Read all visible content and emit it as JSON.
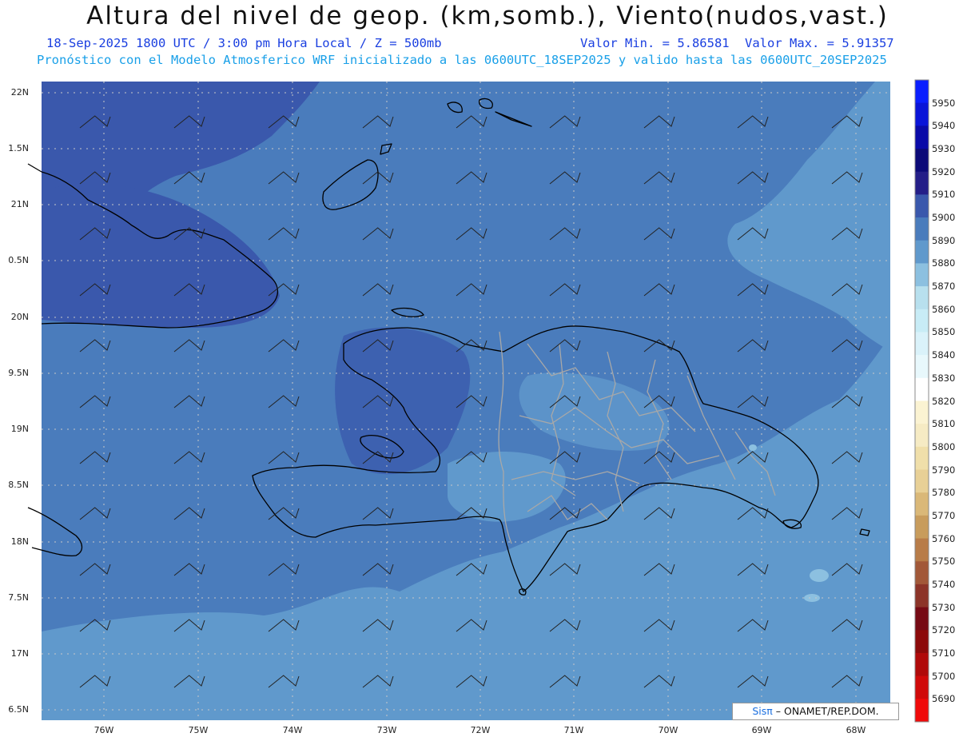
{
  "header": {
    "title": "Altura del nivel de geop. (km,somb.), Viento(nudos,vast.)",
    "date_line": "18-Sep-2025  1800 UTC / 3:00 pm Hora Local / Z = 500mb",
    "min_line": "Valor Min. = 5.86581",
    "max_line": "Valor Max. = 5.91357",
    "model_line": "Pronóstico con el Modelo Atmosferico WRF inicializado a las 0600UTC_18SEP2025 y valido hasta las  0600UTC_20SEP2025"
  },
  "axes": {
    "lat_labels": [
      "22N",
      "1.5N",
      "21N",
      "0.5N",
      "20N",
      "9.5N",
      "19N",
      "8.5N",
      "18N",
      "7.5N",
      "17N",
      "6.5N"
    ],
    "lon_labels": [
      "76W",
      "75W",
      "74W",
      "73W",
      "72W",
      "71W",
      "70W",
      "69W",
      "68W"
    ]
  },
  "colorbar": {
    "levels": [
      "5950",
      "5940",
      "5930",
      "5920",
      "5910",
      "5900",
      "5890",
      "5880",
      "5870",
      "5860",
      "5850",
      "5840",
      "5830",
      "5820",
      "5810",
      "5800",
      "5790",
      "5780",
      "5770",
      "5760",
      "5750",
      "5740",
      "5730",
      "5720",
      "5710",
      "5700",
      "5690"
    ],
    "colors": [
      "#0a1eff",
      "#0a14d8",
      "#0a0aa8",
      "#0c0a78",
      "#241e88",
      "#3a58ac",
      "#4a7cbc",
      "#6099cc",
      "#8cc0e0",
      "#b8e0ee",
      "#c8ecf6",
      "#daf2fa",
      "#e8f8fc",
      "#ffffff",
      "#fbf3d2",
      "#f6ebc4",
      "#f0dfaa",
      "#e8d096",
      "#dab878",
      "#c89c5c",
      "#b87c48",
      "#a25838",
      "#8c3428",
      "#760a14",
      "#8c0a0a",
      "#b00a0a",
      "#d00a0a",
      "#f00a0a"
    ]
  },
  "map_colors": {
    "shade_5890": "#4a7cbc",
    "shade_5900": "#3a58ac",
    "shade_5880": "#6099cc",
    "shade_5870": "#8cc0e0",
    "coast": "#000000",
    "provinces": "#a8a8a8"
  },
  "credit": {
    "sis": "Sisπ",
    "rest": "– ONAMET/REP.DOM."
  }
}
